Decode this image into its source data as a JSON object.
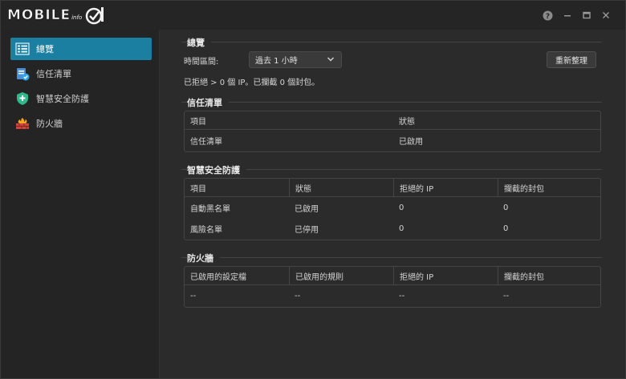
{
  "app": {
    "logo_text": "MOBILE",
    "logo_sub": "info",
    "title_buttons": {
      "help": "?",
      "minimize": "–",
      "maximize": "▢",
      "close": "✕"
    }
  },
  "sidebar": {
    "items": [
      {
        "label": "總覽",
        "icon": "overview-icon",
        "active": true
      },
      {
        "label": "信任清單",
        "icon": "trust-list-icon",
        "active": false
      },
      {
        "label": "智慧安全防護",
        "icon": "shield-icon",
        "active": false
      },
      {
        "label": "防火牆",
        "icon": "firewall-icon",
        "active": false
      }
    ]
  },
  "overview": {
    "title": "總覽",
    "time_range_label": "時間區間:",
    "time_range_value": "過去 1 小時",
    "refresh_button": "重新整理",
    "summary": "已拒絕 > 0 個 IP。已攔截 0 個封包。"
  },
  "trust_list": {
    "title": "信任清單",
    "columns": [
      "項目",
      "狀態"
    ],
    "rows": [
      [
        "信任清單",
        "已啟用"
      ]
    ]
  },
  "smart_protection": {
    "title": "智慧安全防護",
    "columns": [
      "項目",
      "狀態",
      "拒絕的 IP",
      "攔截的封包"
    ],
    "rows": [
      [
        "自動黑名單",
        "已啟用",
        "0",
        "0"
      ],
      [
        "風險名單",
        "已停用",
        "0",
        "0"
      ]
    ]
  },
  "firewall": {
    "title": "防火牆",
    "columns": [
      "已啟用的設定檔",
      "已啟用的規則",
      "拒絕的 IP",
      "攔截的封包"
    ],
    "rows": [
      [
        "--",
        "--",
        "--",
        "--"
      ]
    ]
  },
  "colors": {
    "accent": "#1a7fa0",
    "background": "#2b2b2c",
    "border": "#454545"
  }
}
